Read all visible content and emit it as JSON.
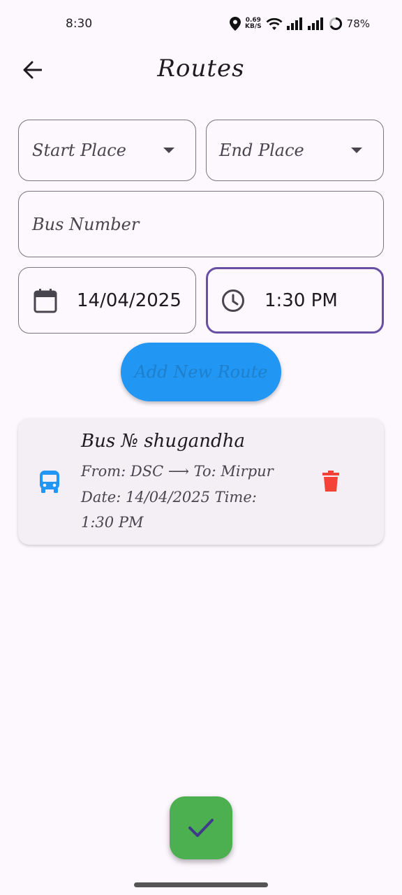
{
  "status": {
    "time": "8:30",
    "net_speed_value": "0.69",
    "net_speed_unit": "KB/S",
    "battery": "78%"
  },
  "header": {
    "title": "Routes"
  },
  "form": {
    "start_place_label": "Start Place",
    "end_place_label": "End Place",
    "bus_number_label": "Bus Number",
    "date_value": "14/04/2025",
    "time_value": "1:30 PM",
    "add_button_label": "Add New Route"
  },
  "routes": [
    {
      "title": "Bus № shugandha",
      "from_to": "From: DSC ⟶ To: Mirpur",
      "date_time_line1": "Date: 14/04/2025 Time:",
      "date_time_line2": "1:30 PM"
    }
  ],
  "colors": {
    "background": "#fdf7fe",
    "focus_border": "#6750a4",
    "add_button": "#2196f3",
    "bus_icon": "#2196f3",
    "delete_icon": "#f44336",
    "fab": "#4caf50",
    "check_icon": "#3f3a8a"
  },
  "icons": {
    "back": "arrow-left-icon",
    "calendar": "calendar-icon",
    "clock": "clock-icon",
    "bus": "bus-icon",
    "delete": "trash-icon",
    "fab": "check-icon"
  }
}
